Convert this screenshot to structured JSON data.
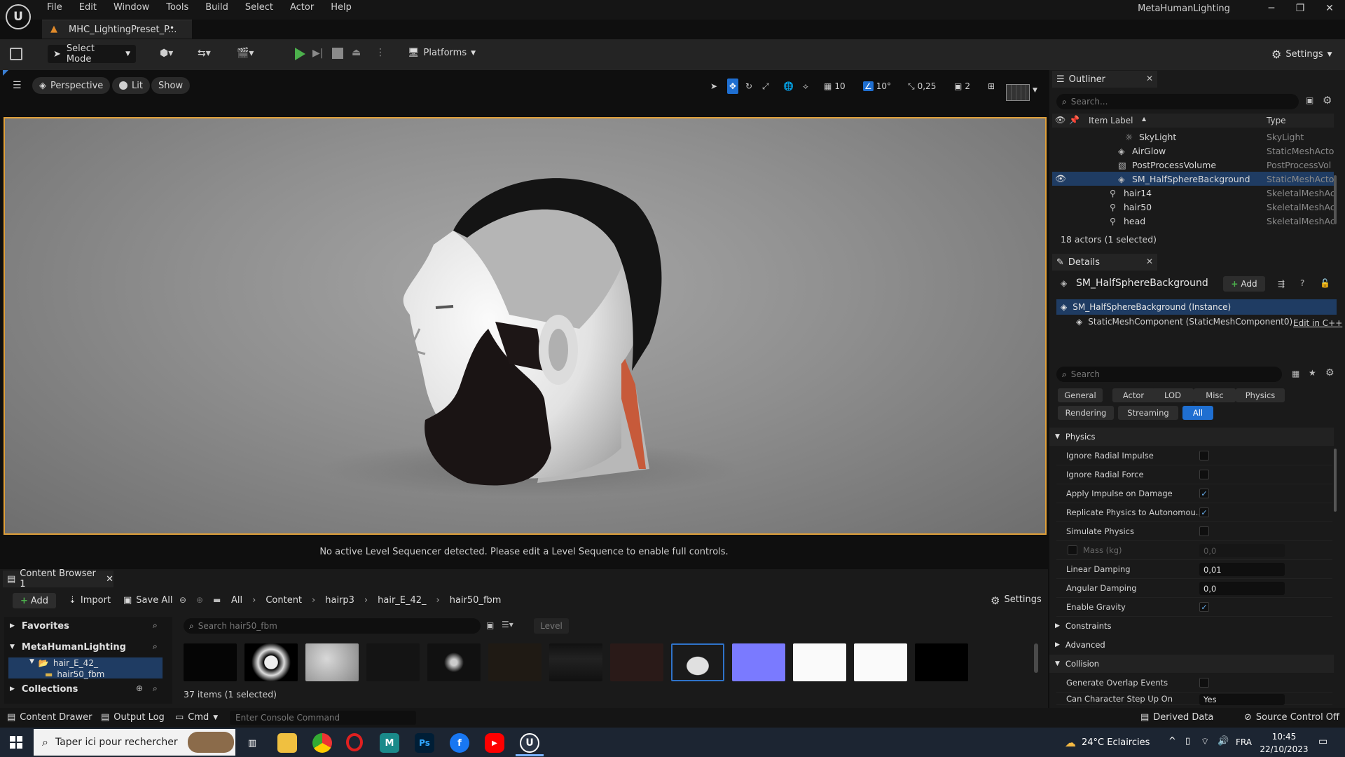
{
  "menu": {
    "items": [
      "File",
      "Edit",
      "Window",
      "Tools",
      "Build",
      "Select",
      "Actor",
      "Help"
    ]
  },
  "window": {
    "title": "MetaHumanLighting",
    "minimize": "─",
    "restore": "❐",
    "close": "✕"
  },
  "doc_tab": {
    "label": "MHC_LightingPreset_P...",
    "dirty": "•"
  },
  "toolbar": {
    "select_mode": "Select Mode",
    "platforms": "Platforms",
    "settings": "Settings"
  },
  "viewport": {
    "perspective": "Perspective",
    "lit": "Lit",
    "show": "Show",
    "grid_snap": "10",
    "rot_snap": "10°",
    "scale_snap": "0,25",
    "cam_speed": "2",
    "sequencer_msg": "No active Level Sequencer detected. Please edit a Level Sequence to enable full controls."
  },
  "outliner": {
    "title": "Outliner",
    "search_placeholder": "Search...",
    "col_label": "Item Label",
    "col_type": "Type",
    "rows": [
      {
        "label": "SkyLight",
        "type": "SkyLight",
        "icon": "skylight-icon"
      },
      {
        "label": "AirGlow",
        "type": "StaticMeshActo",
        "icon": "static-mesh-icon"
      },
      {
        "label": "PostProcessVolume",
        "type": "PostProcessVol",
        "icon": "volume-icon"
      },
      {
        "label": "SM_HalfSphereBackground",
        "type": "StaticMeshActo",
        "icon": "static-mesh-icon"
      },
      {
        "label": "hair14",
        "type": "SkeletalMeshAc",
        "icon": "skeletal-mesh-icon"
      },
      {
        "label": "hair50",
        "type": "SkeletalMeshAc",
        "icon": "skeletal-mesh-icon"
      },
      {
        "label": "head",
        "type": "SkeletalMeshAc",
        "icon": "skeletal-mesh-icon"
      }
    ],
    "status": "18 actors (1 selected)"
  },
  "details": {
    "title": "Details",
    "actor_name": "SM_HalfSphereBackground",
    "add": "Add",
    "instance": "SM_HalfSphereBackground (Instance)",
    "component": "StaticMeshComponent (StaticMeshComponent0)",
    "edit_cpp": "Edit in C++",
    "search_placeholder": "Search",
    "categories": [
      "General",
      "Actor",
      "LOD",
      "Misc",
      "Physics",
      "Rendering",
      "Streaming",
      "All"
    ],
    "physics_section": "Physics",
    "props": [
      {
        "label": "Ignore Radial Impulse",
        "kind": "check",
        "value": ""
      },
      {
        "label": "Ignore Radial Force",
        "kind": "check",
        "value": ""
      },
      {
        "label": "Apply Impulse on Damage",
        "kind": "check",
        "value": "✓"
      },
      {
        "label": "Replicate Physics to Autonomou...",
        "kind": "check",
        "value": "✓"
      },
      {
        "label": "Simulate Physics",
        "kind": "check",
        "value": ""
      },
      {
        "label": "Mass (kg)",
        "kind": "num-disabled",
        "value": "0,0"
      },
      {
        "label": "Linear Damping",
        "kind": "num",
        "value": "0,01"
      },
      {
        "label": "Angular Damping",
        "kind": "num",
        "value": "0,0"
      },
      {
        "label": "Enable Gravity",
        "kind": "check",
        "value": "✓"
      }
    ],
    "constraints": "Constraints",
    "advanced": "Advanced",
    "collision": "Collision",
    "gen_overlap": "Generate Overlap Events",
    "can_step": "Can Character Step Up On",
    "can_step_value": "Yes"
  },
  "content_browser": {
    "tab": "Content Browser 1",
    "add": "Add",
    "import": "Import",
    "save_all": "Save All",
    "breadcrumb": [
      "All",
      "Content",
      "hairp3",
      "hair_E_42_",
      "hair50_fbm"
    ],
    "settings": "Settings",
    "favorites": "Favorites",
    "project": "MetaHumanLighting",
    "tree": [
      "hair_E_42_",
      "hair50_fbm"
    ],
    "collections": "Collections",
    "search_placeholder": "Search hair50_fbm",
    "level": "Level",
    "count": "37 items (1 selected)"
  },
  "statusbar": {
    "content_drawer": "Content Drawer",
    "output_log": "Output Log",
    "cmd": "Cmd",
    "console_placeholder": "Enter Console Command",
    "derived_data": "Derived Data",
    "source_control": "Source Control Off"
  },
  "taskbar": {
    "search": "Taper ici pour rechercher",
    "weather": "24°C  Eclaircies",
    "lang": "FRA",
    "time": "10:45",
    "date": "22/10/2023"
  },
  "colors": {
    "accent": "#1f6fd1",
    "selection": "#1f3c63",
    "viewport_border": "#e0a03a",
    "play": "#4cb04c"
  }
}
